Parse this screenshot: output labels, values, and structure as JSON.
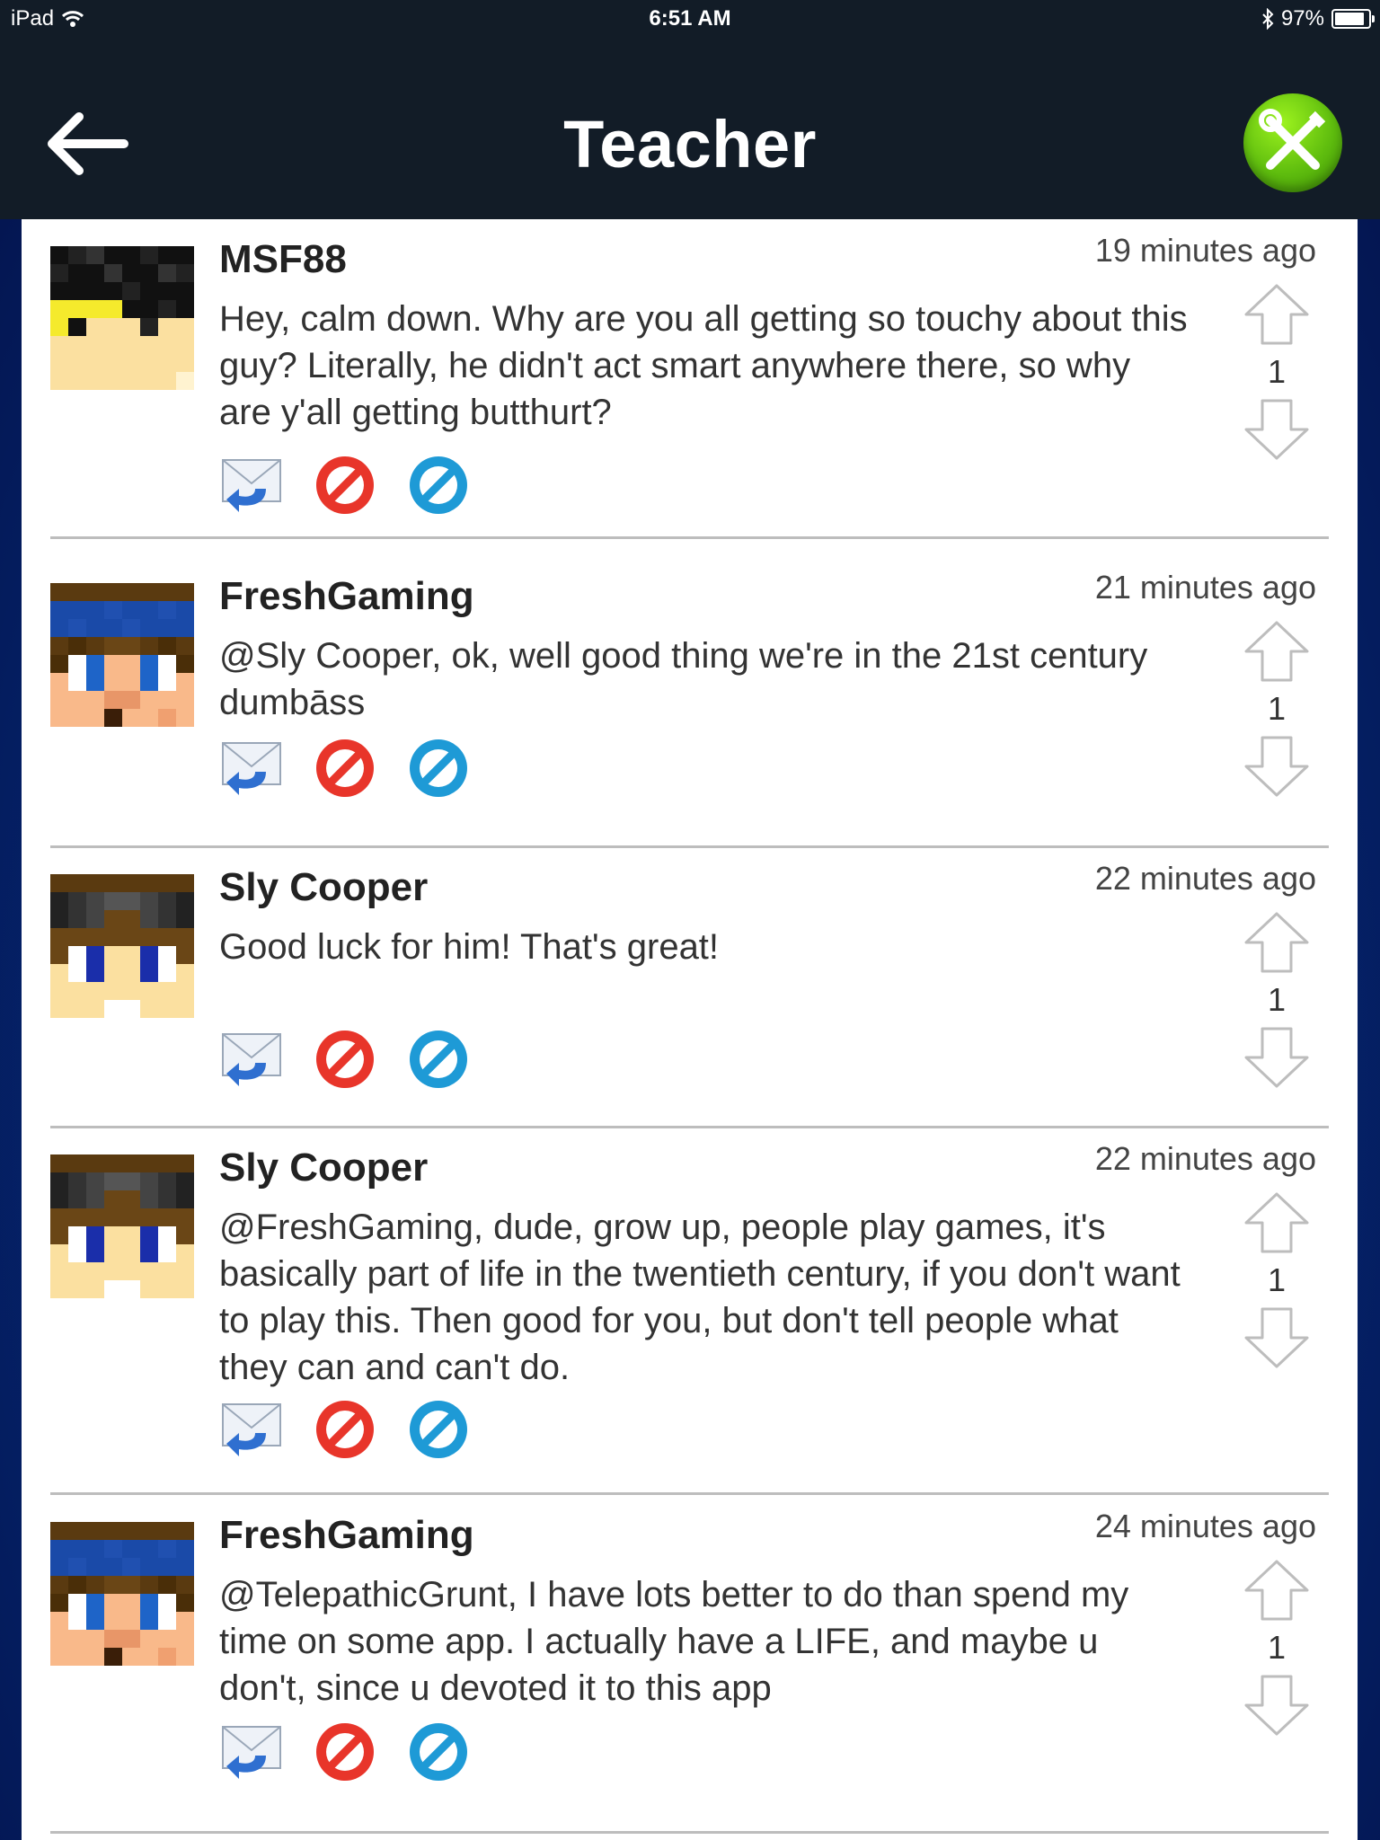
{
  "status_bar": {
    "carrier": "iPad",
    "time": "6:51 AM",
    "battery": "97%"
  },
  "header": {
    "title": "Teacher"
  },
  "colors": {
    "nav_bg": "#121c27",
    "accent_green": "#5fbd0e",
    "block_red": "#e8352a",
    "block_blue": "#1e9ad6"
  },
  "comments": [
    {
      "username": "MSF88",
      "time": "19 minutes ago",
      "text": "Hey, calm down. Why are you all getting so touchy about this guy? Literally, he didn't act smart anywhere there, so why are y'all getting butthurt?",
      "score": "1"
    },
    {
      "username": "FreshGaming",
      "time": "21 minutes ago",
      "text": "@Sly Cooper, ok, well good thing we're in the 21st century dumbāss",
      "score": "1"
    },
    {
      "username": "Sly Cooper",
      "time": "22 minutes ago",
      "text": "Good luck for him! That's great!",
      "score": "1"
    },
    {
      "username": "Sly Cooper",
      "time": "22 minutes ago",
      "text": "@FreshGaming, dude, grow up, people play games, it's basically part of life in the twentieth century, if you don't want to play this. Then good for you, but don't tell people what they can and can't do.",
      "score": "1"
    },
    {
      "username": "FreshGaming",
      "time": "24 minutes ago",
      "text": "@TelepathicGrunt, I have lots better to do than spend my time on some app. I actually have a LIFE, and maybe u don't, since u devoted it to this app",
      "score": "1"
    }
  ]
}
